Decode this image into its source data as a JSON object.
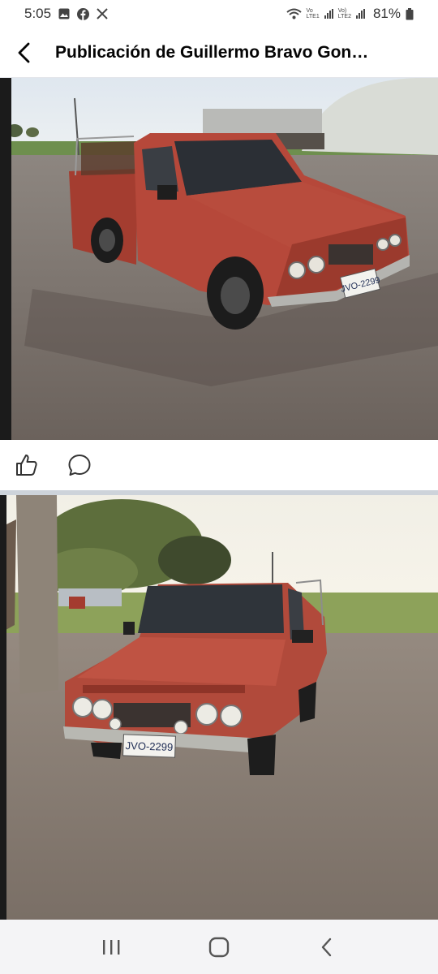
{
  "status_bar": {
    "time": "5:05",
    "battery": "81%",
    "network_1": "Vo\nLTE1",
    "network_2": "Vo)\nLTE2",
    "left_icons": [
      "gallery-icon",
      "facebook-icon",
      "x-twitter-icon"
    ],
    "right_icons": [
      "wifi-icon",
      "signal-icon",
      "battery-icon"
    ]
  },
  "header": {
    "title": "Publicación de Guillermo Bravo Gon…"
  },
  "photos": [
    {
      "plate": "JVO-2299"
    },
    {
      "plate": "JVO-2299"
    }
  ],
  "actions": [
    "like-icon",
    "comment-icon"
  ],
  "nav": [
    "recent-apps-icon",
    "home-icon",
    "back-icon"
  ]
}
